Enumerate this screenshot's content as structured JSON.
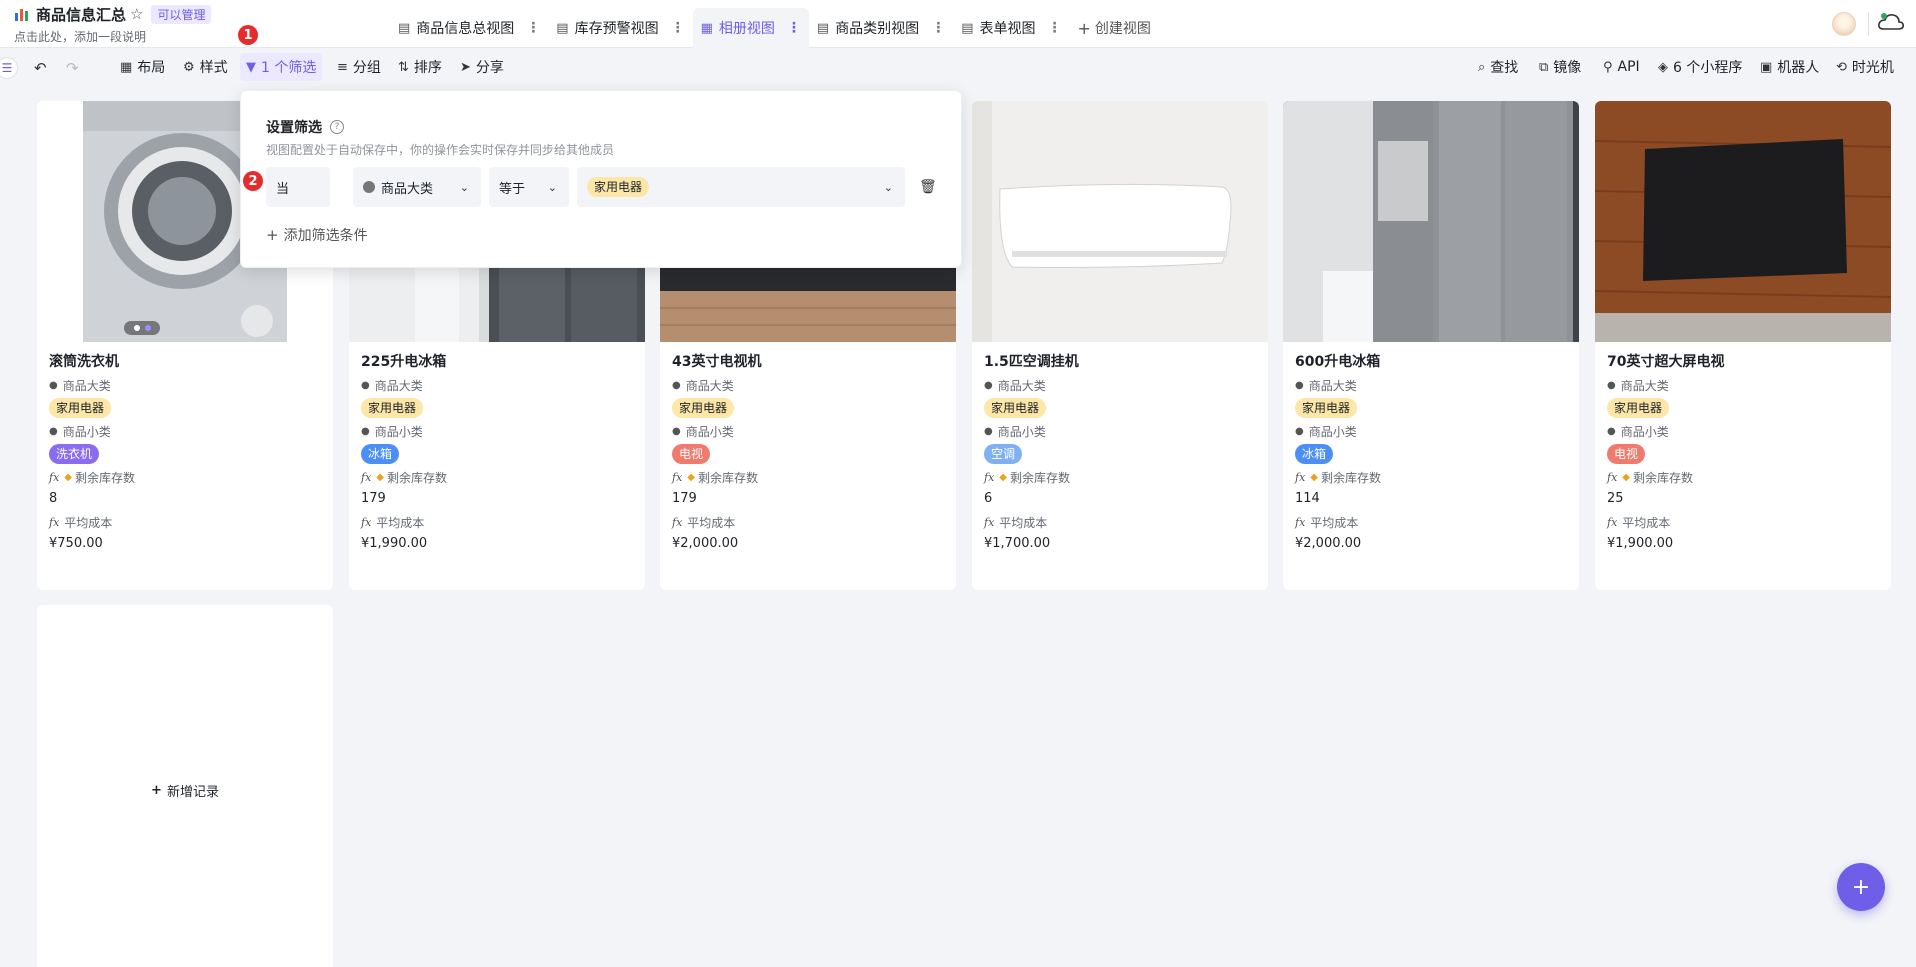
{
  "header": {
    "title": "商品信息汇总",
    "permission_badge": "可以管理",
    "description": "点击此处，添加一段说明",
    "views": [
      {
        "label": "商品信息总视图",
        "icon": "grid-view-icon"
      },
      {
        "label": "库存预警视图",
        "icon": "grid-view-icon"
      },
      {
        "label": "相册视图",
        "icon": "gallery-view-icon",
        "active": true
      },
      {
        "label": "商品类别视图",
        "icon": "grid-view-icon"
      },
      {
        "label": "表单视图",
        "icon": "form-view-icon"
      }
    ],
    "create_view": "创建视图"
  },
  "toolbar": {
    "layout": "布局",
    "style": "样式",
    "filter": "1 个筛选",
    "group": "分组",
    "sort": "排序",
    "share": "分享",
    "search": "查找",
    "mirror": "镜像",
    "api": "API",
    "mini_programs": "6 个小程序",
    "robot": "机器人",
    "time_machine": "时光机"
  },
  "annotations": {
    "one": "1",
    "two": "2"
  },
  "filter_popup": {
    "title": "设置筛选",
    "description": "视图配置处于自动保存中，你的操作会实时保存并同步给其他成员",
    "condition": {
      "prefix": "当",
      "field": "商品大类",
      "operator": "等于",
      "value": "家用电器"
    },
    "add_condition": "添加筛选条件"
  },
  "field_labels": {
    "category": "商品大类",
    "subcategory": "商品小类",
    "stock": "剩余库存数",
    "avg_cost": "平均成本"
  },
  "cards": [
    {
      "title": "滚筒洗衣机",
      "category": "家用电器",
      "subcategory": "洗衣机",
      "sub_color": "#8a6cf0",
      "stock": "8",
      "avg_cost": "¥750.00"
    },
    {
      "title": "225升电冰箱",
      "category": "家用电器",
      "subcategory": "冰箱",
      "sub_color": "#4b8ef5",
      "stock": "179",
      "avg_cost": "¥1,990.00"
    },
    {
      "title": "43英寸电视机",
      "category": "家用电器",
      "subcategory": "电视",
      "sub_color": "#f07a6e",
      "stock": "179",
      "avg_cost": "¥2,000.00"
    },
    {
      "title": "1.5匹空调挂机",
      "category": "家用电器",
      "subcategory": "空调",
      "sub_color": "#7fb1f2",
      "stock": "6",
      "avg_cost": "¥1,700.00"
    },
    {
      "title": "600升电冰箱",
      "category": "家用电器",
      "subcategory": "冰箱",
      "sub_color": "#4b8ef5",
      "stock": "114",
      "avg_cost": "¥2,000.00"
    },
    {
      "title": "70英寸超大屏电视",
      "category": "家用电器",
      "subcategory": "电视",
      "sub_color": "#f07a6e",
      "stock": "25",
      "avg_cost": "¥1,900.00"
    }
  ],
  "new_record": "新增记录",
  "fab": "+"
}
